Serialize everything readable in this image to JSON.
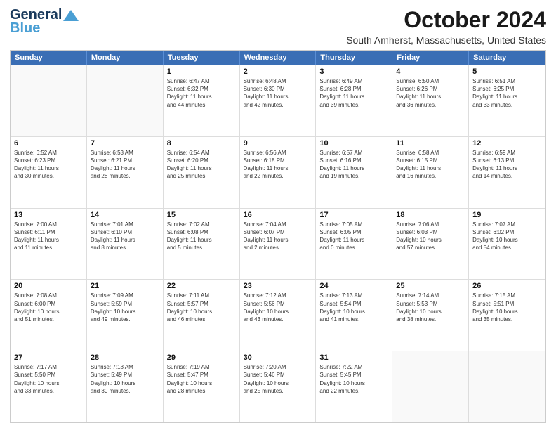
{
  "header": {
    "logo_line1": "General",
    "logo_line2": "Blue",
    "main_title": "October 2024",
    "subtitle": "South Amherst, Massachusetts, United States"
  },
  "days_of_week": [
    "Sunday",
    "Monday",
    "Tuesday",
    "Wednesday",
    "Thursday",
    "Friday",
    "Saturday"
  ],
  "weeks": [
    [
      {
        "day": "",
        "lines": []
      },
      {
        "day": "",
        "lines": []
      },
      {
        "day": "1",
        "lines": [
          "Sunrise: 6:47 AM",
          "Sunset: 6:32 PM",
          "Daylight: 11 hours",
          "and 44 minutes."
        ]
      },
      {
        "day": "2",
        "lines": [
          "Sunrise: 6:48 AM",
          "Sunset: 6:30 PM",
          "Daylight: 11 hours",
          "and 42 minutes."
        ]
      },
      {
        "day": "3",
        "lines": [
          "Sunrise: 6:49 AM",
          "Sunset: 6:28 PM",
          "Daylight: 11 hours",
          "and 39 minutes."
        ]
      },
      {
        "day": "4",
        "lines": [
          "Sunrise: 6:50 AM",
          "Sunset: 6:26 PM",
          "Daylight: 11 hours",
          "and 36 minutes."
        ]
      },
      {
        "day": "5",
        "lines": [
          "Sunrise: 6:51 AM",
          "Sunset: 6:25 PM",
          "Daylight: 11 hours",
          "and 33 minutes."
        ]
      }
    ],
    [
      {
        "day": "6",
        "lines": [
          "Sunrise: 6:52 AM",
          "Sunset: 6:23 PM",
          "Daylight: 11 hours",
          "and 30 minutes."
        ]
      },
      {
        "day": "7",
        "lines": [
          "Sunrise: 6:53 AM",
          "Sunset: 6:21 PM",
          "Daylight: 11 hours",
          "and 28 minutes."
        ]
      },
      {
        "day": "8",
        "lines": [
          "Sunrise: 6:54 AM",
          "Sunset: 6:20 PM",
          "Daylight: 11 hours",
          "and 25 minutes."
        ]
      },
      {
        "day": "9",
        "lines": [
          "Sunrise: 6:56 AM",
          "Sunset: 6:18 PM",
          "Daylight: 11 hours",
          "and 22 minutes."
        ]
      },
      {
        "day": "10",
        "lines": [
          "Sunrise: 6:57 AM",
          "Sunset: 6:16 PM",
          "Daylight: 11 hours",
          "and 19 minutes."
        ]
      },
      {
        "day": "11",
        "lines": [
          "Sunrise: 6:58 AM",
          "Sunset: 6:15 PM",
          "Daylight: 11 hours",
          "and 16 minutes."
        ]
      },
      {
        "day": "12",
        "lines": [
          "Sunrise: 6:59 AM",
          "Sunset: 6:13 PM",
          "Daylight: 11 hours",
          "and 14 minutes."
        ]
      }
    ],
    [
      {
        "day": "13",
        "lines": [
          "Sunrise: 7:00 AM",
          "Sunset: 6:11 PM",
          "Daylight: 11 hours",
          "and 11 minutes."
        ]
      },
      {
        "day": "14",
        "lines": [
          "Sunrise: 7:01 AM",
          "Sunset: 6:10 PM",
          "Daylight: 11 hours",
          "and 8 minutes."
        ]
      },
      {
        "day": "15",
        "lines": [
          "Sunrise: 7:02 AM",
          "Sunset: 6:08 PM",
          "Daylight: 11 hours",
          "and 5 minutes."
        ]
      },
      {
        "day": "16",
        "lines": [
          "Sunrise: 7:04 AM",
          "Sunset: 6:07 PM",
          "Daylight: 11 hours",
          "and 2 minutes."
        ]
      },
      {
        "day": "17",
        "lines": [
          "Sunrise: 7:05 AM",
          "Sunset: 6:05 PM",
          "Daylight: 11 hours",
          "and 0 minutes."
        ]
      },
      {
        "day": "18",
        "lines": [
          "Sunrise: 7:06 AM",
          "Sunset: 6:03 PM",
          "Daylight: 10 hours",
          "and 57 minutes."
        ]
      },
      {
        "day": "19",
        "lines": [
          "Sunrise: 7:07 AM",
          "Sunset: 6:02 PM",
          "Daylight: 10 hours",
          "and 54 minutes."
        ]
      }
    ],
    [
      {
        "day": "20",
        "lines": [
          "Sunrise: 7:08 AM",
          "Sunset: 6:00 PM",
          "Daylight: 10 hours",
          "and 51 minutes."
        ]
      },
      {
        "day": "21",
        "lines": [
          "Sunrise: 7:09 AM",
          "Sunset: 5:59 PM",
          "Daylight: 10 hours",
          "and 49 minutes."
        ]
      },
      {
        "day": "22",
        "lines": [
          "Sunrise: 7:11 AM",
          "Sunset: 5:57 PM",
          "Daylight: 10 hours",
          "and 46 minutes."
        ]
      },
      {
        "day": "23",
        "lines": [
          "Sunrise: 7:12 AM",
          "Sunset: 5:56 PM",
          "Daylight: 10 hours",
          "and 43 minutes."
        ]
      },
      {
        "day": "24",
        "lines": [
          "Sunrise: 7:13 AM",
          "Sunset: 5:54 PM",
          "Daylight: 10 hours",
          "and 41 minutes."
        ]
      },
      {
        "day": "25",
        "lines": [
          "Sunrise: 7:14 AM",
          "Sunset: 5:53 PM",
          "Daylight: 10 hours",
          "and 38 minutes."
        ]
      },
      {
        "day": "26",
        "lines": [
          "Sunrise: 7:15 AM",
          "Sunset: 5:51 PM",
          "Daylight: 10 hours",
          "and 35 minutes."
        ]
      }
    ],
    [
      {
        "day": "27",
        "lines": [
          "Sunrise: 7:17 AM",
          "Sunset: 5:50 PM",
          "Daylight: 10 hours",
          "and 33 minutes."
        ]
      },
      {
        "day": "28",
        "lines": [
          "Sunrise: 7:18 AM",
          "Sunset: 5:49 PM",
          "Daylight: 10 hours",
          "and 30 minutes."
        ]
      },
      {
        "day": "29",
        "lines": [
          "Sunrise: 7:19 AM",
          "Sunset: 5:47 PM",
          "Daylight: 10 hours",
          "and 28 minutes."
        ]
      },
      {
        "day": "30",
        "lines": [
          "Sunrise: 7:20 AM",
          "Sunset: 5:46 PM",
          "Daylight: 10 hours",
          "and 25 minutes."
        ]
      },
      {
        "day": "31",
        "lines": [
          "Sunrise: 7:22 AM",
          "Sunset: 5:45 PM",
          "Daylight: 10 hours",
          "and 22 minutes."
        ]
      },
      {
        "day": "",
        "lines": []
      },
      {
        "day": "",
        "lines": []
      }
    ]
  ]
}
